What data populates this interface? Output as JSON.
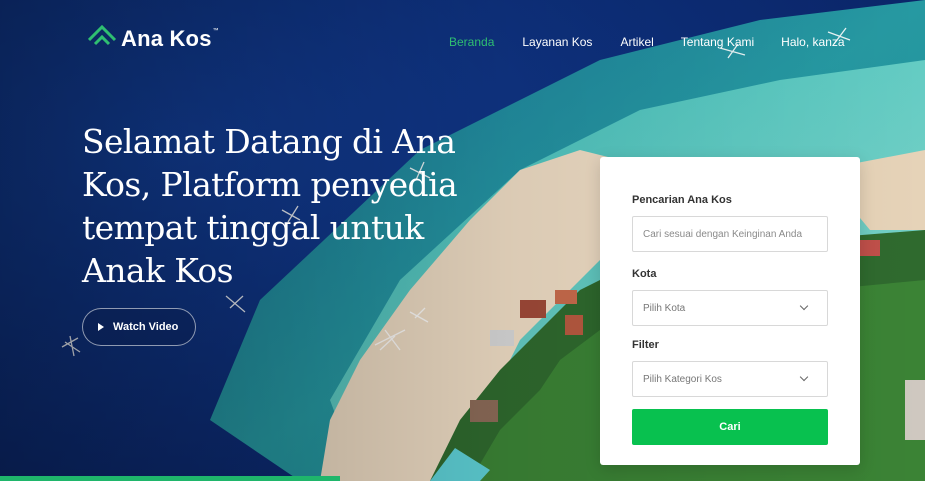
{
  "brand": {
    "name": "Ana Kos",
    "tm": "™",
    "accent_color": "#2fbf71",
    "logo_icon": "house-roof-icon"
  },
  "nav": {
    "items": [
      {
        "label": "Beranda",
        "active": true
      },
      {
        "label": "Layanan Kos",
        "active": false
      },
      {
        "label": "Artikel",
        "active": false
      },
      {
        "label": "Tentang Kami",
        "active": false
      },
      {
        "label": "Halo, kanza",
        "active": false
      }
    ]
  },
  "hero": {
    "title": "Selamat Datang di Ana Kos, Platform penyedia tempat tinggal untuk Anak Kos",
    "watch_video_label": "Watch Video",
    "watch_video_icon": "play-icon"
  },
  "search_form": {
    "search_label": "Pencarian Ana Kos",
    "search_placeholder": "Cari sesuai dengan Keinginan Anda",
    "city_label": "Kota",
    "city_value": "Pilih Kota",
    "filter_label": "Filter",
    "filter_value": "Pilih Kategori Kos",
    "submit_label": "Cari",
    "submit_color": "#08c14f"
  }
}
